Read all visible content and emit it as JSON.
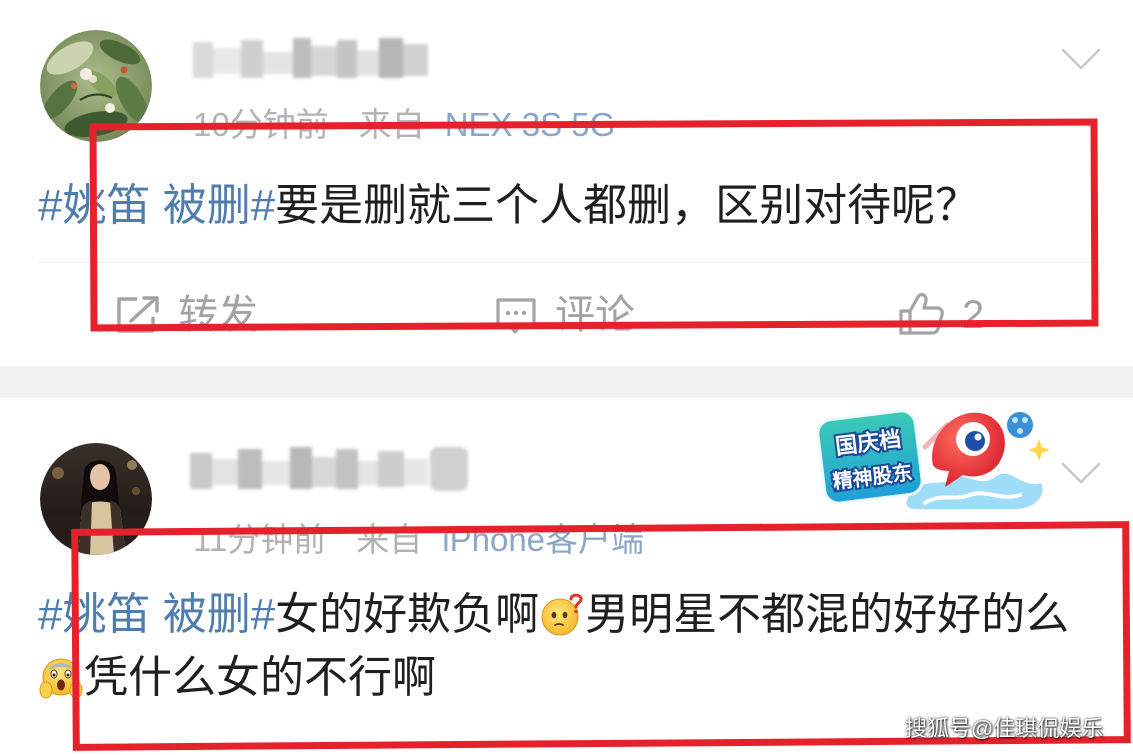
{
  "colors": {
    "background": "#ffffff",
    "separator": "#f2f2f2",
    "divider": "#ededed",
    "text": "#1f1f1f",
    "hashtag": "#507daf",
    "meta": "#b2b2b2",
    "source": "#8aa6c7",
    "action": "#a3a3a3",
    "annotation": "#e5222b",
    "watermark": "#ffffff"
  },
  "feed": {
    "posts": [
      {
        "avatar_icon": "user-avatar-icon",
        "menu_icon": "chevron-down-icon",
        "meta": {
          "time": "10分钟前",
          "source_prefix": "来自",
          "device": "NEX 3S 5G"
        },
        "body": {
          "hashtag": "#姚笛 被删#",
          "text": "要是删就三个人都删，区别对待呢？"
        },
        "actions": {
          "repost": {
            "icon": "repost-icon",
            "label": "转发"
          },
          "comment": {
            "icon": "comment-icon",
            "label": "评论"
          },
          "like": {
            "icon": "thumbs-up-icon",
            "count": 2
          }
        }
      },
      {
        "avatar_icon": "user-avatar-icon",
        "menu_icon": "chevron-down-icon",
        "badge": {
          "line_1": "国庆档",
          "line_2": "精神股东"
        },
        "meta": {
          "time": "11分钟前",
          "source_prefix": "来自",
          "device": "iPhone客户端"
        },
        "body": {
          "hashtag": "#姚笛 被删#",
          "text_1": "女的好欺负啊",
          "emoji_1": "question-face-icon",
          "text_2": "男明星不都混的好好的么",
          "emoji_2": "scared-face-icon",
          "text_3": "凭什么女的不行啊"
        }
      }
    ]
  },
  "watermark": {
    "text": "搜狐号@佳琪侃娱乐"
  }
}
